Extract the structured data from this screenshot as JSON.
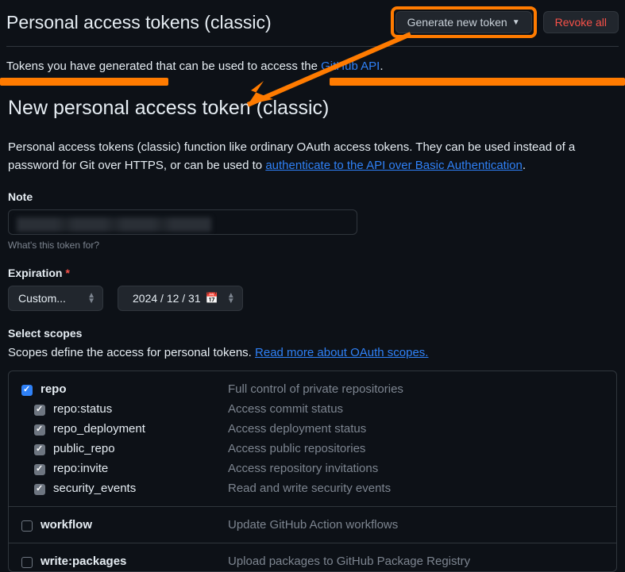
{
  "header": {
    "title": "Personal access tokens (classic)",
    "generate_btn": "Generate new token",
    "revoke_btn": "Revoke all"
  },
  "intro": {
    "prefix": "Tokens you have generated that can be used to access the ",
    "link_text": "GitHub API",
    "suffix": "."
  },
  "form": {
    "title": "New personal access token (classic)",
    "desc_prefix": "Personal access tokens (classic) function like ordinary OAuth access tokens. They can be used instead of a password for Git over HTTPS, or can be used to ",
    "desc_link": "authenticate to the API over Basic Authentication",
    "desc_suffix": ".",
    "note_label": "Note",
    "note_help": "What's this token for?",
    "expiration_label": "Expiration",
    "expiration_mode": "Custom...",
    "expiration_date": "2024 / 12 / 31",
    "scopes_label": "Select scopes",
    "scopes_desc_prefix": "Scopes define the access for personal tokens. ",
    "scopes_link": "Read more about OAuth scopes."
  },
  "scopes": [
    {
      "name": "repo",
      "desc": "Full control of private repositories",
      "checked": true,
      "children": [
        {
          "name": "repo:status",
          "desc": "Access commit status",
          "checked": true
        },
        {
          "name": "repo_deployment",
          "desc": "Access deployment status",
          "checked": true
        },
        {
          "name": "public_repo",
          "desc": "Access public repositories",
          "checked": true
        },
        {
          "name": "repo:invite",
          "desc": "Access repository invitations",
          "checked": true
        },
        {
          "name": "security_events",
          "desc": "Read and write security events",
          "checked": true
        }
      ]
    },
    {
      "name": "workflow",
      "desc": "Update GitHub Action workflows",
      "checked": false,
      "children": []
    },
    {
      "name": "write:packages",
      "desc": "Upload packages to GitHub Package Registry",
      "checked": false,
      "children": []
    }
  ]
}
